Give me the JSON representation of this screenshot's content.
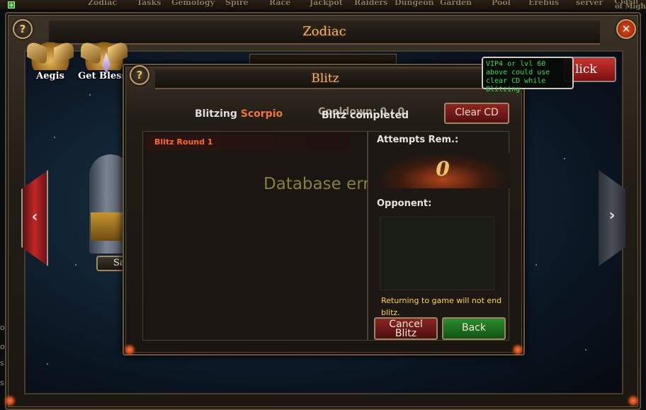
{
  "top_nav": {
    "items": [
      "Zodiac",
      "Tasks",
      "Gemology",
      "Spire",
      "Race",
      "Jackpot",
      "Raiders",
      "Dungeon",
      "Garden",
      "Pool",
      "Erebus",
      "server"
    ],
    "corner_text_1": "Clash",
    "corner_text_2": "of Migh"
  },
  "left_strip": [
    "oi",
    "o",
    "s",
    "s"
  ],
  "zodiac": {
    "title": "Zodiac",
    "badges": [
      {
        "label": "Aegis",
        "icon": "aegis-wings-icon"
      },
      {
        "label": "Get Blessi",
        "icon": "blessing-crystal-icon"
      }
    ],
    "field_text": "Zodiac",
    "side_button_label": "Sa",
    "quick_button_label": "lick",
    "help_glyph": "?",
    "close_glyph": "✕",
    "left_arrow_glyph": "‹",
    "right_arrow_glyph": "›"
  },
  "blitz": {
    "title": "Blitz",
    "help_glyph": "?",
    "blitzing_prefix": "Blitzing",
    "blitzing_sign": "Scorpio",
    "countdown_text": "Cooldown: 0 : 0",
    "completed_text": "Blitz completed",
    "clear_cd_label": "Clear CD",
    "log_rows": [
      "Blitz Round 1"
    ],
    "error_text": "Database error",
    "attempts_label": "Attempts Rem.:",
    "attempts_value": "0",
    "opponent_label": "Opponent:",
    "notice": "Returning to game will not end blitz.",
    "cancel_label_line1": "Cancel",
    "cancel_label_line2": "Blitz",
    "back_label": "Back",
    "tooltip": "VIP4 or lvl 60 above could use clear CD while Blitzing"
  },
  "colors": {
    "title_gold": "#e8b774",
    "sign_orange": "#f2743e",
    "log_text": "#ff6a2b",
    "notice_yellow": "#ffd73a",
    "tooltip_green": "#35e04a",
    "error_olive": "#85803a"
  }
}
